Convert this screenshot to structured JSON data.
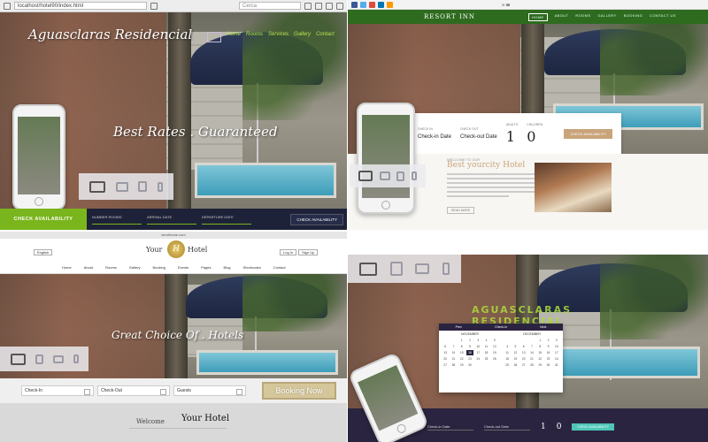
{
  "quad1": {
    "url": "localhost/hotel90/index.html",
    "search_placeholder": "Cerca",
    "site_title": "Aguasclaras Residencial",
    "nav": [
      "Home",
      "Rooms",
      "Services",
      "Gallery",
      "Contact"
    ],
    "hero_text": "Best Rates . Guaranteed",
    "check_label": "CHECK AVAILABILITY",
    "fields": [
      "NUMBER ROOMS",
      "ARRIVAL DATE",
      "DEPARTURE DATE"
    ],
    "check_button": "CHECK AVAILABILITY"
  },
  "quad2": {
    "logo": "RESORT INN",
    "menu": [
      "HOME",
      "ABOUT",
      "ROOMS",
      "GALLERY",
      "BOOKING",
      "CONTACT US"
    ],
    "booking": {
      "checkin_label": "CHECK IN",
      "checkin_value": "Check-in Date",
      "checkout_label": "CHECK OUT",
      "checkout_value": "Check-out Date",
      "adults_label": "ADULTS",
      "adults_value": "1",
      "children_label": "CHILDREN",
      "children_value": "0",
      "button": "CHECK AVAILABILITY"
    },
    "welcome_small": "WELCOME TO OUR",
    "title": "Best yourcity Hotel",
    "more": "READ MORE"
  },
  "quad3": {
    "url": "serolhome.com",
    "language": "English",
    "logo_left": "Your",
    "logo_emblem": "H",
    "logo_right": "Hotel",
    "auth": [
      "Log In",
      "Sign Up"
    ],
    "menu": [
      "Home",
      "About",
      "Rooms",
      "Gallery",
      "Booking",
      "Events",
      "Pages",
      "Blog",
      "Shortcodes",
      "Contact"
    ],
    "hero_text": "Great Choice Of . Hotels",
    "checkin": "Check-In",
    "checkout": "Check-Out",
    "guests": "Guests",
    "booking_button": "Booking Now",
    "welcome": "Welcome",
    "your_hotel": "Your Hotel"
  },
  "quad4": {
    "ghost_title_line1": "AGUASCLARAS",
    "ghost_title_line2": "RESIDENCIAL",
    "cal_head": [
      "Prev",
      "Check-in",
      "Next"
    ],
    "month_left": "NOVEMBER",
    "month_right": "DECEMBER",
    "days_left": [
      "",
      "",
      "1",
      "2",
      "3",
      "4",
      "5",
      "6",
      "7",
      "8",
      "9",
      "10",
      "11",
      "12",
      "13",
      "14",
      "15",
      "16",
      "17",
      "18",
      "19",
      "20",
      "21",
      "22",
      "23",
      "24",
      "25",
      "26",
      "27",
      "28",
      "29",
      "30"
    ],
    "days_right": [
      "",
      "",
      "",
      "",
      "1",
      "2",
      "3",
      "4",
      "5",
      "6",
      "7",
      "8",
      "9",
      "10",
      "11",
      "12",
      "13",
      "14",
      "15",
      "16",
      "17",
      "18",
      "19",
      "20",
      "21",
      "22",
      "23",
      "24",
      "25",
      "26",
      "27",
      "28",
      "29",
      "30",
      "31"
    ],
    "selected_day": "16",
    "checkin": "Check-in Date",
    "checkout": "Check-out Date",
    "adults": "1",
    "children": "0",
    "button": "CHECK AVAILABILITY"
  },
  "colors": {
    "green": "#7ab51d",
    "navy": "#1d2238",
    "resort_green": "#2e6b1f",
    "gold": "#c9a47a",
    "purple": "#2b2440"
  }
}
